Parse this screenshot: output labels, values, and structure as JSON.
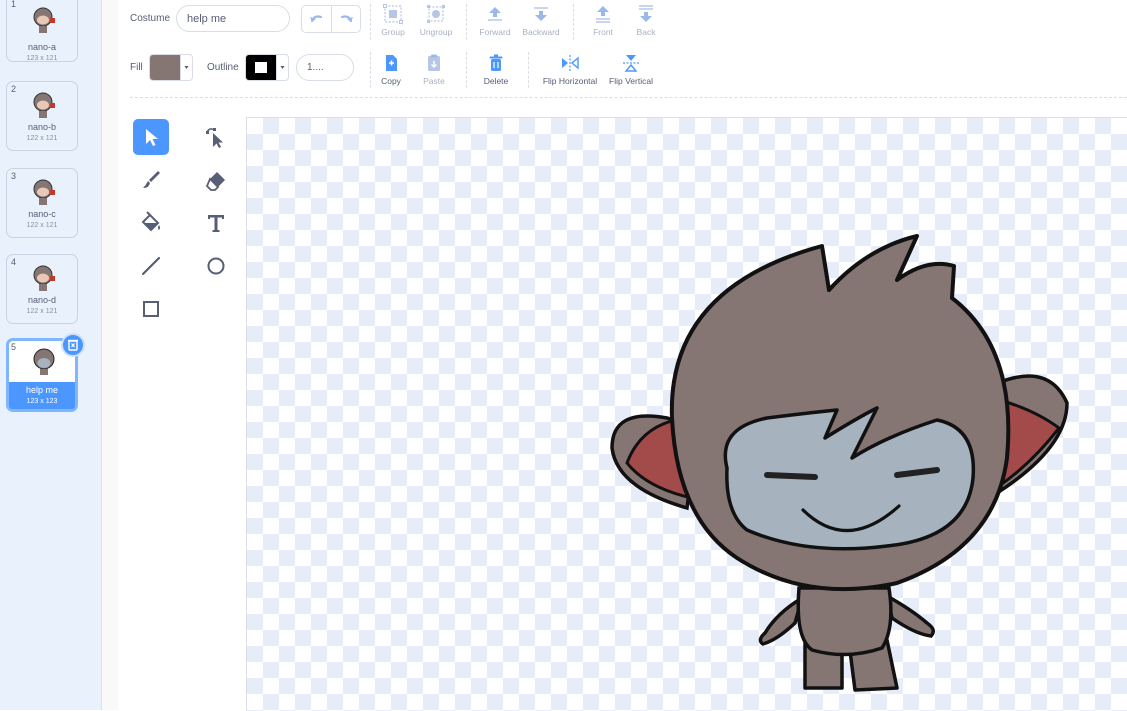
{
  "costumes": [
    {
      "number": "1",
      "name": "nano-a",
      "size": "123 x 121"
    },
    {
      "number": "2",
      "name": "nano-b",
      "size": "122 x 121"
    },
    {
      "number": "3",
      "name": "nano-c",
      "size": "122 x 121"
    },
    {
      "number": "4",
      "name": "nano-d",
      "size": "122 x 121"
    },
    {
      "number": "5",
      "name": "help me",
      "size": "123 x 123",
      "selected": true
    }
  ],
  "toolbar": {
    "costume_label": "Costume",
    "costume_name": "help me",
    "group": "Group",
    "ungroup": "Ungroup",
    "forward": "Forward",
    "backward": "Backward",
    "front": "Front",
    "back": "Back",
    "fill_label": "Fill",
    "fill_color": "#857673",
    "outline_label": "Outline",
    "outline_color": "#000000",
    "outline_width": "1....",
    "copy": "Copy",
    "paste": "Paste",
    "delete": "Delete",
    "flip_horizontal": "Flip Horizontal",
    "flip_vertical": "Flip Vertical"
  },
  "tools": [
    "select-tool",
    "reshape-tool",
    "brush-tool",
    "eraser-tool",
    "fill-tool",
    "text-tool",
    "line-tool",
    "circle-tool",
    "rectangle-tool"
  ],
  "active_tool": "select-tool",
  "colors": {
    "accent": "#4c97ff",
    "character_fur": "#857673",
    "character_face": "#a6b3bf",
    "ear_inner": "#a34a4a"
  }
}
